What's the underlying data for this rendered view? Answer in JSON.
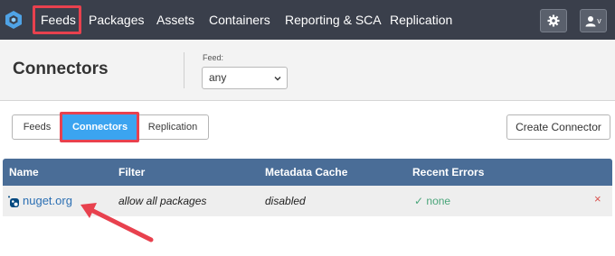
{
  "topbar": {
    "nav": [
      "Feeds",
      "Packages",
      "Assets",
      "Containers",
      "Reporting & SCA",
      "Replication"
    ],
    "settings_icon": "gear-icon",
    "user_icon": "user-icon",
    "user_caret": "v"
  },
  "header": {
    "title": "Connectors",
    "feed_label": "Feed:",
    "feed_value": "any"
  },
  "tabs": [
    "Feeds",
    "Connectors",
    "Replication"
  ],
  "active_tab": "Connectors",
  "create_button": "Create Connector",
  "table": {
    "columns": [
      "Name",
      "Filter",
      "Metadata Cache",
      "Recent Errors"
    ],
    "rows": [
      {
        "name": "nuget.org",
        "filter": "allow all packages",
        "metadata_cache": "disabled",
        "recent_errors": "✓ none",
        "delete": "×"
      }
    ]
  },
  "colors": {
    "topbar": "#3a3f4b",
    "highlight": "#e8414e",
    "active_tab": "#3ba4f0",
    "table_header": "#4a6d97",
    "link": "#2b6fb3",
    "ok": "#4aa57a"
  }
}
